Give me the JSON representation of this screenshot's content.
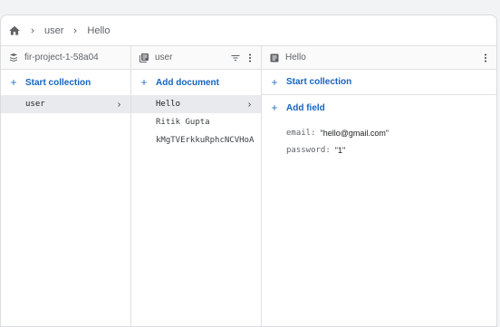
{
  "breadcrumb": {
    "home_icon": "home-icon",
    "items": [
      "user",
      "Hello"
    ]
  },
  "columns": {
    "project": {
      "title": "fir-project-1-58a04",
      "icon": "database-icon",
      "action_label": "Start collection",
      "items": [
        {
          "label": "user",
          "selected": true
        }
      ]
    },
    "collection": {
      "title": "user",
      "icon": "collection-icon",
      "action_label": "Add document",
      "items": [
        {
          "label": "Hello",
          "selected": true
        },
        {
          "label": "Ritik Gupta",
          "selected": false
        },
        {
          "label": "kMgTVErkkuRphcNCVHoA",
          "selected": false
        }
      ]
    },
    "document": {
      "title": "Hello",
      "icon": "document-icon",
      "action_label": "Start collection",
      "add_field_label": "Add field",
      "fields": [
        {
          "key": "email:",
          "value": "\"hello@gmail.com\""
        },
        {
          "key": "password:",
          "value": "\"1\""
        }
      ]
    }
  },
  "colors": {
    "accent": "#1565c0",
    "selected_bg": "#e8eaed"
  }
}
